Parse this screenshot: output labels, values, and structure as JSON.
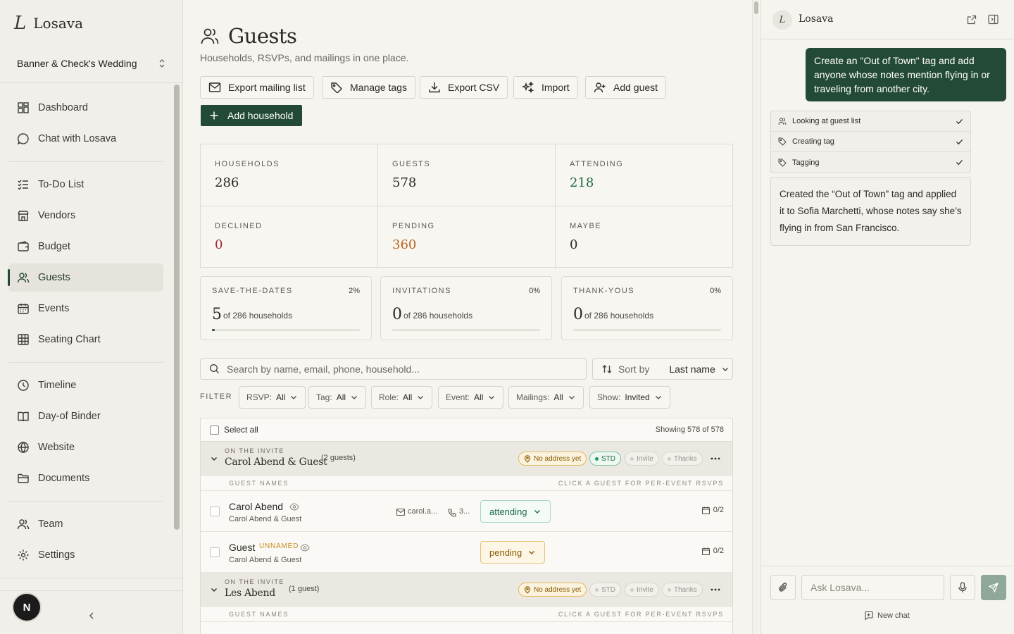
{
  "app": {
    "logo_mark": "L",
    "name": "Losava"
  },
  "project": {
    "name": "Banner & Check's Wedding"
  },
  "nav": {
    "dashboard": "Dashboard",
    "chat": "Chat with Losava",
    "todo": "To-Do List",
    "vendors": "Vendors",
    "budget": "Budget",
    "guests": "Guests",
    "events": "Events",
    "seating": "Seating Chart",
    "timeline": "Timeline",
    "binder": "Day-of Binder",
    "website": "Website",
    "documents": "Documents",
    "team": "Team",
    "settings": "Settings"
  },
  "user": {
    "initial": "N"
  },
  "page": {
    "title": "Guests",
    "subtitle": "Households, RSVPs, and mailings in one place."
  },
  "actions": {
    "export_mailing": "Export mailing list",
    "manage_tags": "Manage tags",
    "export_csv": "Export CSV",
    "import": "Import",
    "add_guest": "Add guest",
    "add_household": "Add household"
  },
  "stats": {
    "households": {
      "label": "HOUSEHOLDS",
      "value": "286"
    },
    "guests": {
      "label": "GUESTS",
      "value": "578"
    },
    "attending": {
      "label": "ATTENDING",
      "value": "218"
    },
    "declined": {
      "label": "DECLINED",
      "value": "0"
    },
    "pending": {
      "label": "PENDING",
      "value": "360"
    },
    "maybe": {
      "label": "MAYBE",
      "value": "0"
    }
  },
  "mailings": {
    "std": {
      "label": "SAVE-THE-DATES",
      "pct": "2%",
      "value": "5",
      "sub": "of 286 households",
      "fill": 0.02
    },
    "inv": {
      "label": "INVITATIONS",
      "pct": "0%",
      "value": "0",
      "sub": "of 286 households",
      "fill": 0
    },
    "thanks": {
      "label": "THANK-YOUS",
      "pct": "0%",
      "value": "0",
      "sub": "of 286 households",
      "fill": 0
    }
  },
  "search": {
    "placeholder": "Search by name, email, phone, household..."
  },
  "sort": {
    "label": "Sort by",
    "value": "Last name"
  },
  "filter": {
    "label": "FILTER",
    "rsvp": {
      "key": "RSVP:",
      "val": "All"
    },
    "tag": {
      "key": "Tag:",
      "val": "All"
    },
    "role": {
      "key": "Role:",
      "val": "All"
    },
    "event": {
      "key": "Event:",
      "val": "All"
    },
    "mailings": {
      "key": "Mailings:",
      "val": "All"
    },
    "show": {
      "key": "Show:",
      "val": "Invited"
    }
  },
  "table": {
    "select_all": "Select all",
    "showing": "Showing 578 of 578",
    "guest_names_label": "GUEST NAMES",
    "click_hint": "CLICK A GUEST FOR PER-EVENT RSVPS",
    "households": [
      {
        "kicker": "ON THE INVITE",
        "name": "Carol Abend & Guest",
        "count": "(2 guests)",
        "address": "No address yet",
        "std": "STD",
        "invite": "Invite",
        "thanks": "Thanks",
        "guests": [
          {
            "name": "Carol Abend",
            "household": "Carol Abend & Guest",
            "email": "carol.a...",
            "phone": "3...",
            "rsvp": "attending",
            "events": "0/2"
          },
          {
            "name": "Guest",
            "tag": "UNNAMED",
            "household": "Carol Abend & Guest",
            "rsvp": "pending",
            "events": "0/2"
          }
        ]
      },
      {
        "kicker": "ON THE INVITE",
        "name": "Les Abend",
        "count": "(1 guest)",
        "address": "No address yet",
        "std": "STD",
        "invite": "Invite",
        "thanks": "Thanks"
      }
    ]
  },
  "chat": {
    "title": "Losava",
    "user_message": "Create an \"Out of Town\" tag and add anyone whose notes mention flying in or traveling from another city.",
    "steps": [
      "Looking at guest list",
      "Creating tag",
      "Tagging"
    ],
    "reply": "Created the “Out of Town” tag and applied it to Sofia Marchetti, whose notes say she’s flying in from San Francisco.",
    "input_placeholder": "Ask Losava...",
    "new_chat": "New chat"
  },
  "colors": {
    "accent": "#234a36",
    "attending": "#1f6b45",
    "declined": "#a0283a",
    "pending": "#b5651d"
  }
}
